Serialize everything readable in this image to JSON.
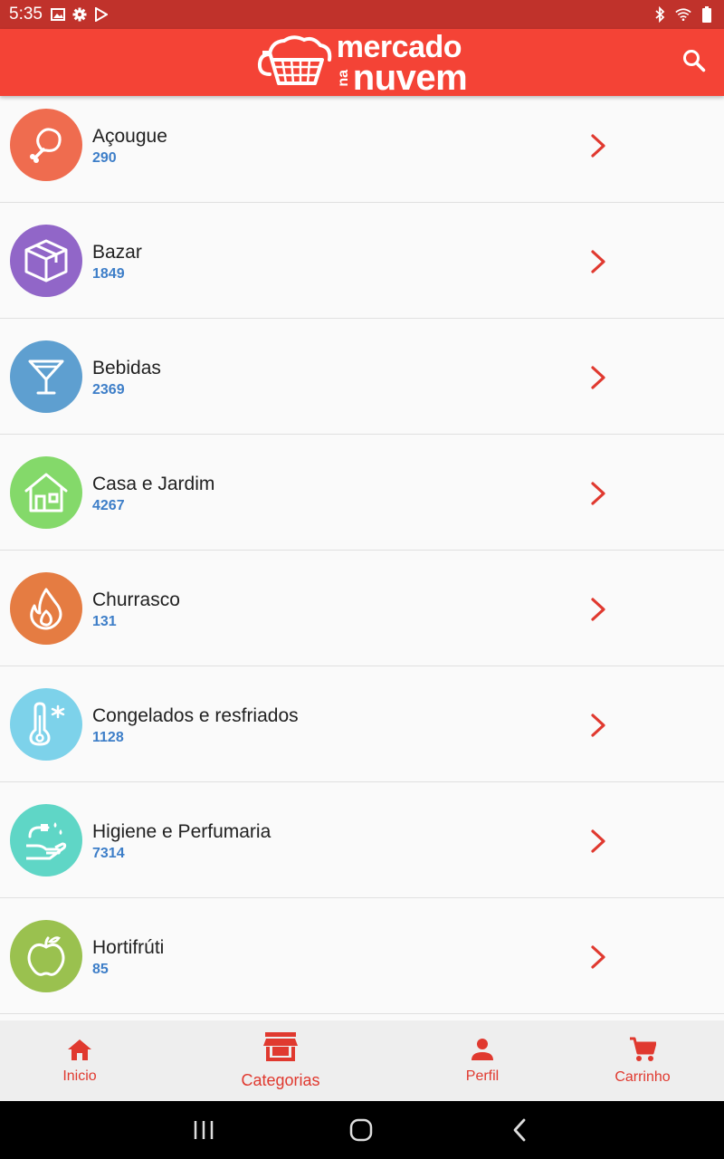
{
  "status_bar": {
    "time": "5:35",
    "left_icons": [
      "image-icon",
      "settings-icon",
      "play-store-icon"
    ],
    "right_icons": [
      "bluetooth-icon",
      "wifi-icon",
      "battery-icon"
    ]
  },
  "app_bar": {
    "logo_top": "mercado",
    "logo_na": "na",
    "logo_bottom": "nuvem",
    "search_icon": "search-icon",
    "color": "#f44336"
  },
  "categories": [
    {
      "label": "Açougue",
      "count": "290",
      "icon": "drumstick-icon",
      "color": "#ef6c4f"
    },
    {
      "label": "Bazar",
      "count": "1849",
      "icon": "box-icon",
      "color": "#9166c8"
    },
    {
      "label": "Bebidas",
      "count": "2369",
      "icon": "cocktail-glass-icon",
      "color": "#5e9fd0"
    },
    {
      "label": "Casa e Jardim",
      "count": "4267",
      "icon": "house-icon",
      "color": "#84d96a"
    },
    {
      "label": "Churrasco",
      "count": "131",
      "icon": "flame-icon",
      "color": "#e57c42"
    },
    {
      "label": "Congelados e resfriados",
      "count": "1128",
      "icon": "thermometer-icon",
      "color": "#7dd2ea"
    },
    {
      "label": "Higiene e Perfumaria",
      "count": "7314",
      "icon": "hand-wash-icon",
      "color": "#5fd6c6"
    },
    {
      "label": "Hortifrúti",
      "count": "85",
      "icon": "apple-icon",
      "color": "#9ac14f"
    }
  ],
  "accent_color": "#e0392f",
  "count_color": "#3d7ec8",
  "bottom_nav": {
    "items": [
      {
        "label": "Inicio",
        "icon": "home-icon"
      },
      {
        "label": "Categorias",
        "icon": "store-icon",
        "active": true
      },
      {
        "label": "Perfil",
        "icon": "person-icon"
      },
      {
        "label": "Carrinho",
        "icon": "cart-icon"
      }
    ]
  },
  "system_nav": [
    "recents-icon",
    "home-circle-icon",
    "back-icon"
  ]
}
